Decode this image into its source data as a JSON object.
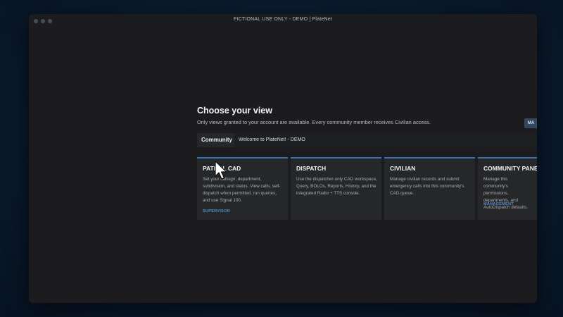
{
  "window": {
    "title": "FICTIONAL USE ONLY - DEMO | PlateNet"
  },
  "page": {
    "heading": "Choose your view",
    "subtext": "Only views granted to your account are available. Every community member receives Civilian access.",
    "corner_button_label": "MA"
  },
  "community": {
    "label": "Community",
    "selected": "Welcome to PlateNet! - DEMO"
  },
  "cards": [
    {
      "title": "PATROL CAD",
      "description": "Set your callsign, department, subdivision, and status. View calls, self-dispatch when permitted, run queries, and use Signal 100.",
      "tag": "SUPERVISOR"
    },
    {
      "title": "DISPATCH",
      "description": "Use the dispatcher-only CAD workspace, Query, BOLOs, Reports, History, and the integrated Radio + TTS console.",
      "tag": ""
    },
    {
      "title": "CIVILIAN",
      "description": "Manage civilian records and submit emergency calls into this community's CAD queue.",
      "tag": ""
    },
    {
      "title": "COMMUNITY PANEL",
      "description": "Manage this community's permissions, departments, and AutoDispatch defaults.",
      "tag": "MANAGEMENT"
    }
  ],
  "colors": {
    "accent": "#3a74b4",
    "tag": "#4f8fd6",
    "card_bg": "#262729",
    "page_bg": "#1c1c1e"
  },
  "icons": {
    "cursor": "mouse-pointer-icon"
  }
}
